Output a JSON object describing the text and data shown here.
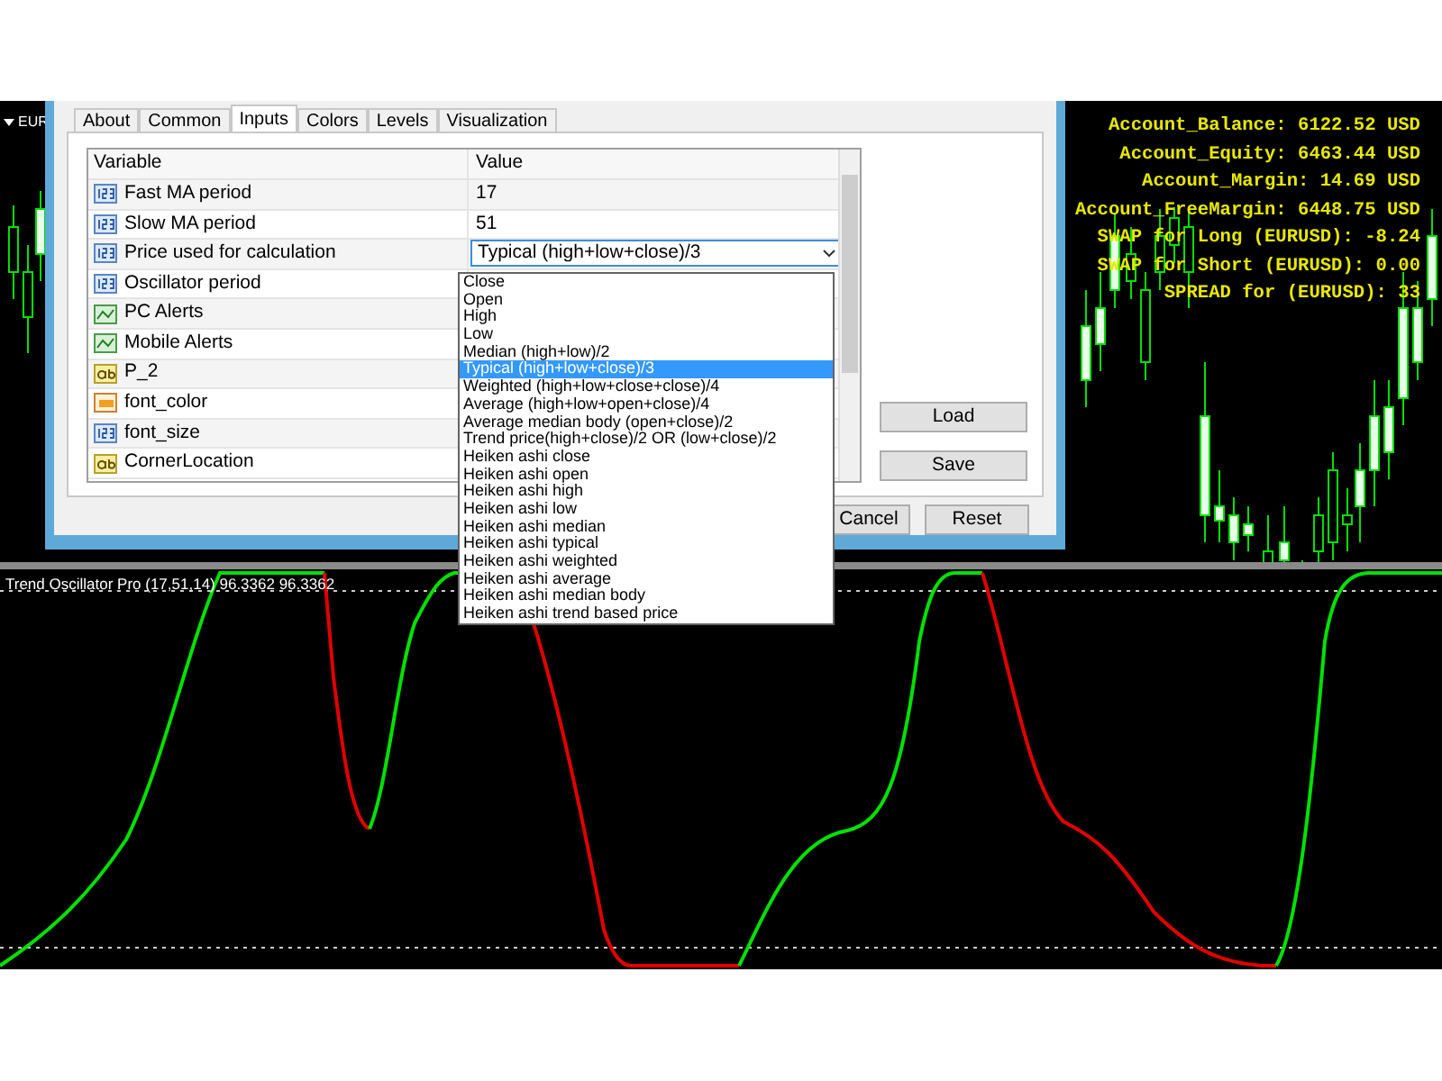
{
  "symbol_label": "EUR",
  "tabs": [
    {
      "label": "About",
      "selected": false
    },
    {
      "label": "Common",
      "selected": false
    },
    {
      "label": "Inputs",
      "selected": true
    },
    {
      "label": "Colors",
      "selected": false
    },
    {
      "label": "Levels",
      "selected": false
    },
    {
      "label": "Visualization",
      "selected": false
    }
  ],
  "grid": {
    "columns": [
      "Variable",
      "Value"
    ],
    "rows": [
      {
        "kind": "number",
        "name": "Fast MA period",
        "value": "17"
      },
      {
        "kind": "number",
        "name": "Slow MA period",
        "value": "51"
      },
      {
        "kind": "number",
        "name": "Price used for calculation",
        "value": "Typical (high+low+close)/3",
        "expanded": true
      },
      {
        "kind": "number",
        "name": "Oscillator period"
      },
      {
        "kind": "alert",
        "name": "PC Alerts"
      },
      {
        "kind": "alert",
        "name": "Mobile Alerts"
      },
      {
        "kind": "text",
        "name": "P_2"
      },
      {
        "kind": "color",
        "name": "font_color"
      },
      {
        "kind": "number",
        "name": "font_size"
      },
      {
        "kind": "text",
        "name": "CornerLocation"
      }
    ]
  },
  "dropdown_options": [
    {
      "label": "Close",
      "selected": false
    },
    {
      "label": "Open",
      "selected": false
    },
    {
      "label": "High",
      "selected": false
    },
    {
      "label": "Low",
      "selected": false
    },
    {
      "label": "Median (high+low)/2",
      "selected": false
    },
    {
      "label": "Typical (high+low+close)/3",
      "selected": true
    },
    {
      "label": "Weighted (high+low+close+close)/4",
      "selected": false
    },
    {
      "label": "Average (high+low+open+close)/4",
      "selected": false
    },
    {
      "label": "Average median body (open+close)/2",
      "selected": false
    },
    {
      "label": "Trend price(high+close)/2 OR (low+close)/2",
      "selected": false
    },
    {
      "label": "Heiken ashi close",
      "selected": false
    },
    {
      "label": "Heiken ashi open",
      "selected": false
    },
    {
      "label": "Heiken ashi high",
      "selected": false
    },
    {
      "label": "Heiken ashi low",
      "selected": false
    },
    {
      "label": "Heiken ashi median",
      "selected": false
    },
    {
      "label": "Heiken ashi typical",
      "selected": false
    },
    {
      "label": "Heiken ashi weighted",
      "selected": false
    },
    {
      "label": "Heiken ashi average",
      "selected": false
    },
    {
      "label": "Heiken ashi median body",
      "selected": false
    },
    {
      "label": "Heiken ashi trend based price",
      "selected": false
    }
  ],
  "side_buttons": [
    "Load",
    "Save"
  ],
  "bottom_buttons": [
    "Cancel",
    "Reset"
  ],
  "account_info": [
    "Account_Balance: 6122.52 USD",
    "Account_Equity: 6463.44 USD",
    "Account_Margin: 14.69 USD",
    "Account_FreeMargin: 6448.75 USD",
    "SWAP for Long (EURUSD): -8.24",
    "SWAP for Short (EURUSD): 0.00",
    "SPREAD for (EURUSD): 33"
  ],
  "indicator_label": "Trend Oscillator Pro (17,51,14) 96.3362 96.3362"
}
